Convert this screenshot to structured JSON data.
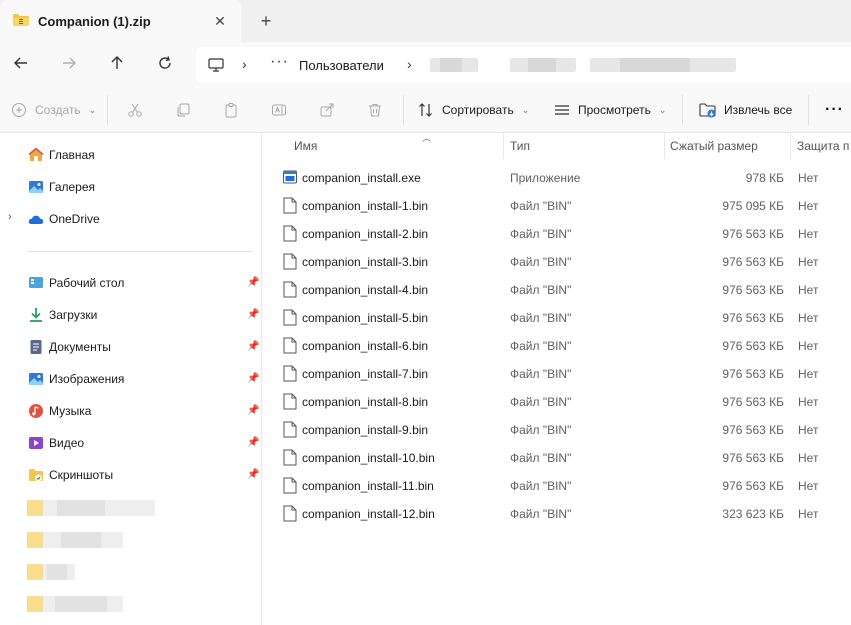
{
  "window": {
    "tab_title": "Companion (1).zip",
    "tab_close": "✕",
    "new_tab": "+"
  },
  "address": {
    "overflow": "···",
    "separator": "›",
    "crumb": "Пользователи"
  },
  "toolbar": {
    "create": "Создать",
    "sort": "Сортировать",
    "view": "Просмотреть",
    "extract_all": "Извлечь все",
    "more": "···"
  },
  "sidebar": {
    "items": [
      {
        "label": "Главная",
        "icon": "home-icon"
      },
      {
        "label": "Галерея",
        "icon": "gallery-icon"
      },
      {
        "label": "OneDrive",
        "icon": "cloud-icon"
      }
    ],
    "quick_access": [
      {
        "label": "Рабочий стол",
        "icon": "desktop-icon",
        "color": "#4aa3df"
      },
      {
        "label": "Загрузки",
        "icon": "download-icon",
        "color": "#2a9d5f"
      },
      {
        "label": "Документы",
        "icon": "document-icon",
        "color": "#5a6b8a"
      },
      {
        "label": "Изображения",
        "icon": "pictures-icon",
        "color": "#2f7bd6"
      },
      {
        "label": "Музыка",
        "icon": "music-icon",
        "color": "#e0533d"
      },
      {
        "label": "Видео",
        "icon": "video-icon",
        "color": "#8e44c7"
      },
      {
        "label": "Скриншоты",
        "icon": "folder-icon",
        "color": "#f2c84b"
      }
    ]
  },
  "columns": {
    "name": "Имя",
    "type": "Тип",
    "size": "Сжатый размер",
    "protection": "Защита п"
  },
  "files": [
    {
      "name": "companion_install.exe",
      "type": "Приложение",
      "size": "978 КБ",
      "prot": "Нет"
    },
    {
      "name": "companion_install-1.bin",
      "type": "Файл \"BIN\"",
      "size": "975 095 КБ",
      "prot": "Нет"
    },
    {
      "name": "companion_install-2.bin",
      "type": "Файл \"BIN\"",
      "size": "976 563 КБ",
      "prot": "Нет"
    },
    {
      "name": "companion_install-3.bin",
      "type": "Файл \"BIN\"",
      "size": "976 563 КБ",
      "prot": "Нет"
    },
    {
      "name": "companion_install-4.bin",
      "type": "Файл \"BIN\"",
      "size": "976 563 КБ",
      "prot": "Нет"
    },
    {
      "name": "companion_install-5.bin",
      "type": "Файл \"BIN\"",
      "size": "976 563 КБ",
      "prot": "Нет"
    },
    {
      "name": "companion_install-6.bin",
      "type": "Файл \"BIN\"",
      "size": "976 563 КБ",
      "prot": "Нет"
    },
    {
      "name": "companion_install-7.bin",
      "type": "Файл \"BIN\"",
      "size": "976 563 КБ",
      "prot": "Нет"
    },
    {
      "name": "companion_install-8.bin",
      "type": "Файл \"BIN\"",
      "size": "976 563 КБ",
      "prot": "Нет"
    },
    {
      "name": "companion_install-9.bin",
      "type": "Файл \"BIN\"",
      "size": "976 563 КБ",
      "prot": "Нет"
    },
    {
      "name": "companion_install-10.bin",
      "type": "Файл \"BIN\"",
      "size": "976 563 КБ",
      "prot": "Нет"
    },
    {
      "name": "companion_install-11.bin",
      "type": "Файл \"BIN\"",
      "size": "976 563 КБ",
      "prot": "Нет"
    },
    {
      "name": "companion_install-12.bin",
      "type": "Файл \"BIN\"",
      "size": "323 623 КБ",
      "prot": "Нет"
    }
  ]
}
